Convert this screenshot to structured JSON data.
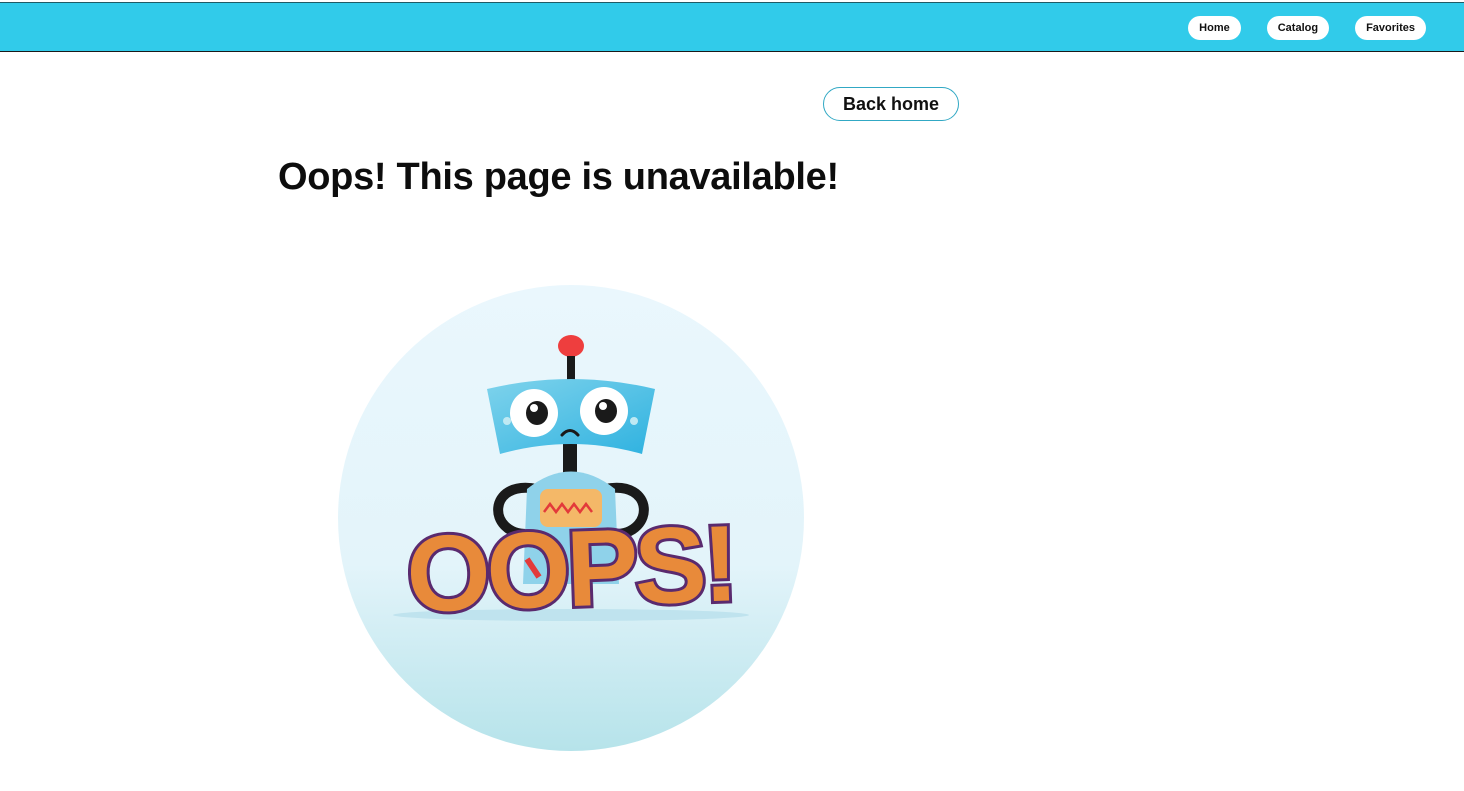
{
  "nav": {
    "items": [
      {
        "label": "Home"
      },
      {
        "label": "Catalog"
      },
      {
        "label": "Favorites"
      }
    ]
  },
  "main": {
    "back_button_label": "Back home",
    "title": "Oops! This page is unavailable!",
    "illustration": {
      "icon": "sad-robot-illustration",
      "text": "OOPS!"
    }
  },
  "colors": {
    "header": "#31cbea",
    "illustration_bg": "#e6f5fb",
    "oops_fill": "#e88a3a",
    "oops_outline": "#5a2a6e",
    "robot_head": "#4fc3e6",
    "antenna_light": "#ee3e3e"
  }
}
